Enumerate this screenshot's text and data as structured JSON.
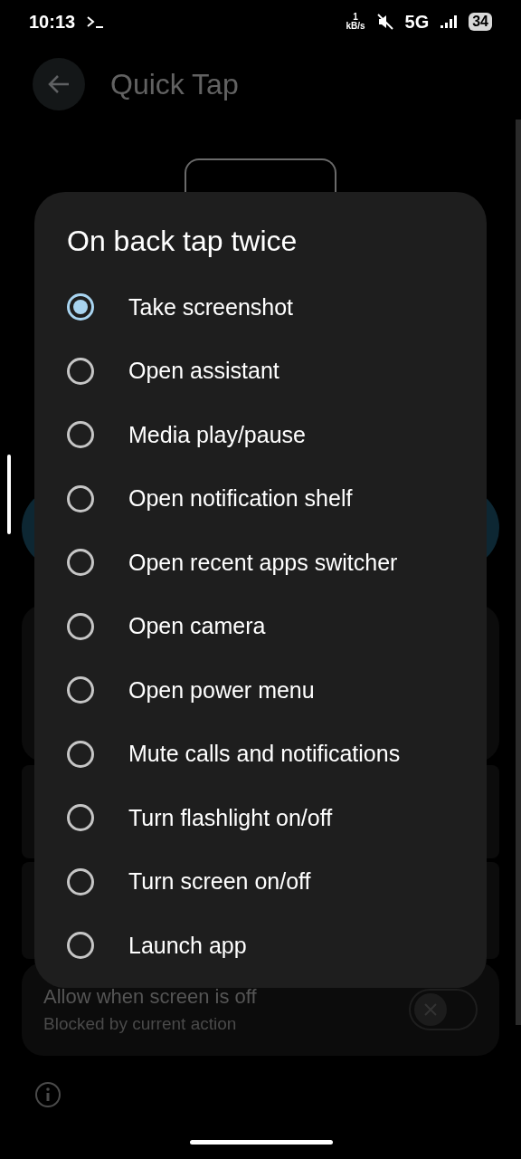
{
  "status_bar": {
    "time": "10:13",
    "speed_value": "1",
    "speed_unit": "kB/s",
    "network": "5G",
    "battery": "34"
  },
  "header": {
    "title": "Quick Tap"
  },
  "setting": {
    "title": "Allow when screen is off",
    "subtitle": "Blocked by current action",
    "on": false
  },
  "dialog": {
    "title": "On back tap twice",
    "options": [
      {
        "label": "Take screenshot",
        "selected": true
      },
      {
        "label": "Open assistant",
        "selected": false
      },
      {
        "label": "Media play/pause",
        "selected": false
      },
      {
        "label": "Open notification shelf",
        "selected": false
      },
      {
        "label": "Open recent apps switcher",
        "selected": false
      },
      {
        "label": "Open camera",
        "selected": false
      },
      {
        "label": "Open power menu",
        "selected": false
      },
      {
        "label": "Mute calls and notifications",
        "selected": false
      },
      {
        "label": "Turn flashlight on/off",
        "selected": false
      },
      {
        "label": "Turn screen on/off",
        "selected": false
      },
      {
        "label": "Launch app",
        "selected": false
      }
    ]
  }
}
